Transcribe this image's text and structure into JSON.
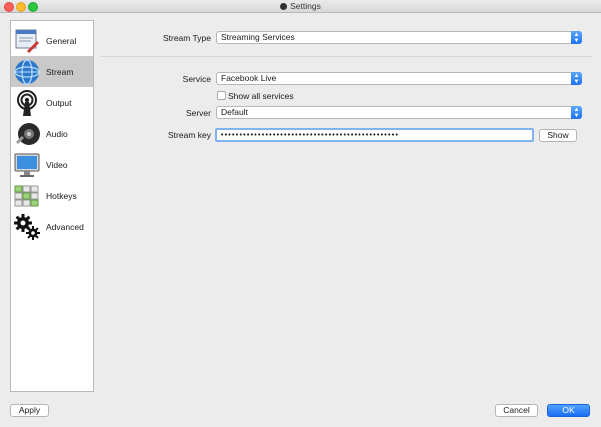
{
  "window": {
    "title": "Settings"
  },
  "sidebar": {
    "items": [
      {
        "label": "General",
        "icon": "general-icon",
        "selected": false
      },
      {
        "label": "Stream",
        "icon": "stream-icon",
        "selected": true
      },
      {
        "label": "Output",
        "icon": "output-icon",
        "selected": false
      },
      {
        "label": "Audio",
        "icon": "audio-icon",
        "selected": false
      },
      {
        "label": "Video",
        "icon": "video-icon",
        "selected": false
      },
      {
        "label": "Hotkeys",
        "icon": "hotkeys-icon",
        "selected": false
      },
      {
        "label": "Advanced",
        "icon": "advanced-icon",
        "selected": false
      }
    ]
  },
  "stream": {
    "type_label": "Stream Type",
    "type_value": "Streaming Services",
    "service_label": "Service",
    "service_value": "Facebook Live",
    "show_all_label": "Show all services",
    "show_all_checked": false,
    "server_label": "Server",
    "server_value": "Default",
    "key_label": "Stream key",
    "key_value": "••••••••••••••••••••••••••••••••••••••••••••••••",
    "show_button": "Show"
  },
  "footer": {
    "apply": "Apply",
    "cancel": "Cancel",
    "ok": "OK"
  },
  "colors": {
    "accent": "#1e73f0",
    "focus_ring": "#7fb3f1",
    "selected_bg": "#c9c9c9"
  }
}
